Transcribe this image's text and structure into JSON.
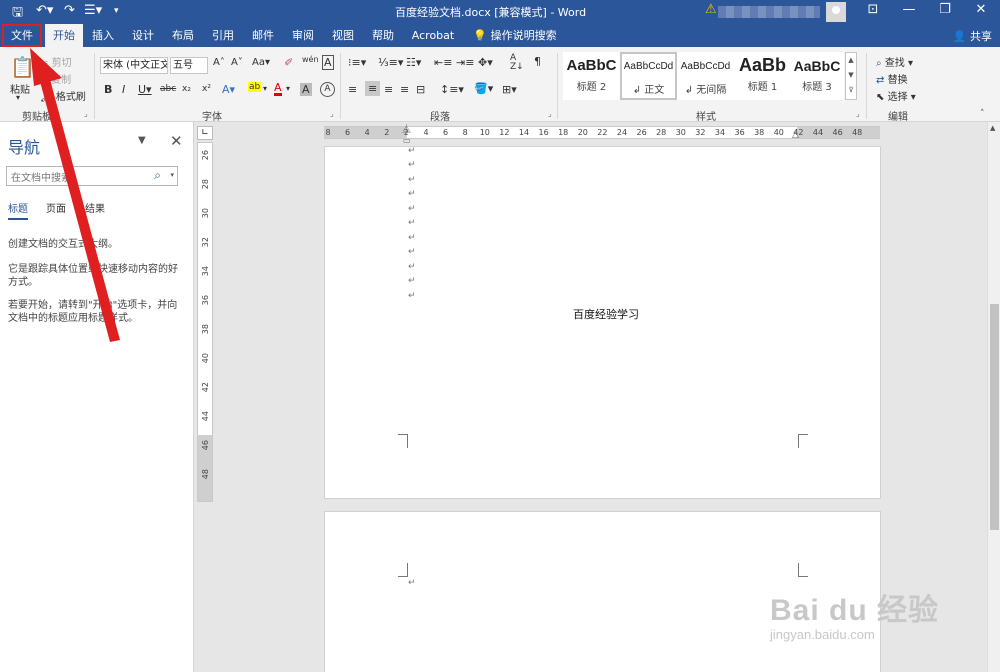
{
  "window": {
    "title": "百度经验文档.docx [兼容模式] - Word"
  },
  "colors": {
    "accent": "#2b579a",
    "annotation": "#e02020"
  },
  "tabs": [
    {
      "label": "文件"
    },
    {
      "label": "开始"
    },
    {
      "label": "插入"
    },
    {
      "label": "设计"
    },
    {
      "label": "布局"
    },
    {
      "label": "引用"
    },
    {
      "label": "邮件"
    },
    {
      "label": "审阅"
    },
    {
      "label": "视图"
    },
    {
      "label": "帮助"
    },
    {
      "label": "Acrobat"
    }
  ],
  "tell_me": "操作说明搜索",
  "share_label": "共享",
  "ribbon": {
    "clipboard": {
      "paste": "粘贴",
      "cut": "剪切",
      "copy": "复制",
      "format_painter": "格式刷",
      "label": "剪贴板"
    },
    "font": {
      "font_name": "宋体 (中文正文",
      "font_size": "五号",
      "label": "字体"
    },
    "paragraph": {
      "label": "段落"
    },
    "styles": {
      "label": "样式",
      "items": [
        {
          "preview": "AaBbC",
          "name": "标题 2"
        },
        {
          "preview": "AaBbCcDd",
          "name": "↲ 正文"
        },
        {
          "preview": "AaBbCcDd",
          "name": "↲ 无间隔"
        },
        {
          "preview": "AaBb",
          "name": "标题 1"
        },
        {
          "preview": "AaBbC",
          "name": "标题 3"
        }
      ]
    },
    "editing": {
      "find": "查找",
      "replace": "替换",
      "select": "选择",
      "label": "编辑"
    }
  },
  "nav": {
    "title": "导航",
    "search_placeholder": "在文档中搜索",
    "tabs": [
      {
        "label": "标题"
      },
      {
        "label": "页面"
      },
      {
        "label": "结果"
      }
    ],
    "help": [
      "创建文档的交互式大纲。",
      "它是跟踪具体位置或快速移动内容的好方式。",
      "若要开始，请转到\"开始\"选项卡，并向文档中的标题应用标题样式。"
    ]
  },
  "ruler_h": [
    "8",
    "6",
    "4",
    "2",
    "2",
    "4",
    "6",
    "8",
    "10",
    "12",
    "14",
    "16",
    "18",
    "20",
    "22",
    "24",
    "26",
    "28",
    "30",
    "32",
    "34",
    "36",
    "38",
    "40",
    "42",
    "44",
    "46",
    "48"
  ],
  "ruler_v": [
    "26",
    "28",
    "30",
    "32",
    "34",
    "36",
    "38",
    "40",
    "42",
    "44",
    "46",
    "48"
  ],
  "document": {
    "paragraph_mark": "↵",
    "text": "百度经验学习"
  },
  "watermark": {
    "brand": "Bai du 经验",
    "url": "jingyan.baidu.com"
  }
}
